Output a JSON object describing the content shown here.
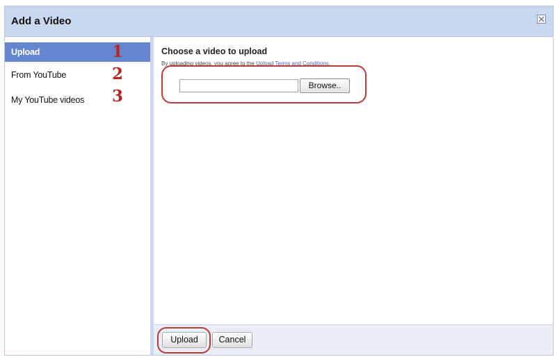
{
  "dialog": {
    "title": "Add a Video",
    "close_icon": "close-icon"
  },
  "sidebar": {
    "items": [
      {
        "label": "Upload",
        "number": "1",
        "selected": true
      },
      {
        "label": "From YouTube",
        "number": "2",
        "selected": false
      },
      {
        "label": "My YouTube videos",
        "number": "3",
        "selected": false
      }
    ]
  },
  "main": {
    "heading": "Choose a video to upload",
    "terms_prefix": "By uploading videos, you agree to the",
    "terms_link": "Upload Terms and Conditions",
    "terms_suffix": ".",
    "file_input_value": "",
    "browse_label": "Browse.."
  },
  "footer": {
    "upload_label": "Upload",
    "cancel_label": "Cancel"
  },
  "colors": {
    "title_bar": "#c9d7ef",
    "selected_item": "#6386cf",
    "annotation_red": "#b5261e",
    "link": "#4a5fae"
  }
}
